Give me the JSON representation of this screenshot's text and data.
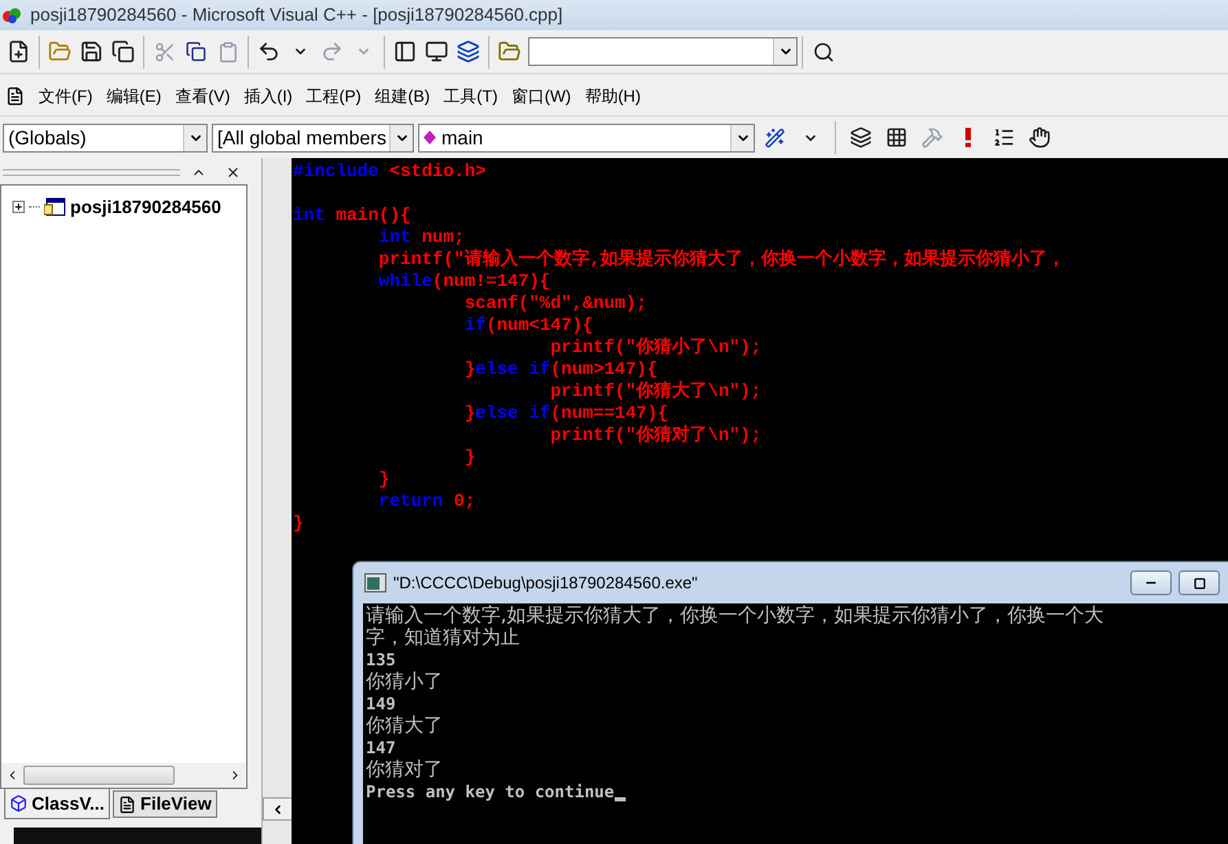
{
  "window": {
    "title": "posji18790284560 - Microsoft Visual C++ - [posji18790284560.cpp]"
  },
  "menu": [
    {
      "label": "文件(F)"
    },
    {
      "label": "编辑(E)"
    },
    {
      "label": "查看(V)"
    },
    {
      "label": "插入(I)"
    },
    {
      "label": "工程(P)"
    },
    {
      "label": "组建(B)"
    },
    {
      "label": "工具(T)"
    },
    {
      "label": "窗口(W)"
    },
    {
      "label": "帮助(H)"
    }
  ],
  "wizard_bar": {
    "scope": "(Globals)",
    "members": "[All global members",
    "function": "main"
  },
  "workspace": {
    "tree": [
      {
        "label": "posji18790284560",
        "expanded": false
      }
    ],
    "tabs": [
      {
        "label": "ClassV...",
        "selected": true
      },
      {
        "label": "FileView",
        "selected": false
      }
    ]
  },
  "editor": {
    "lines": [
      [
        {
          "kind": "keyword",
          "text": "#include"
        },
        {
          "kind": "plain",
          "text": " <stdio.h>"
        }
      ],
      [
        {
          "kind": "blank"
        }
      ],
      [
        {
          "kind": "keyword",
          "text": "int"
        },
        {
          "kind": "plain",
          "text": " main(){"
        }
      ],
      [
        {
          "kind": "keyword",
          "text": "        int"
        },
        {
          "kind": "plain",
          "text": " num;"
        }
      ],
      [
        {
          "kind": "plain",
          "text": "        printf(\"请输入一个数字,如果提示你猜大了，你换一个小数字，如果提示你猜小了，"
        }
      ],
      [
        {
          "kind": "keyword",
          "text": "        while"
        },
        {
          "kind": "plain",
          "text": "(num!=147){"
        }
      ],
      [
        {
          "kind": "plain",
          "text": "                scanf(\"%d\",&num);"
        }
      ],
      [
        {
          "kind": "keyword",
          "text": "                if"
        },
        {
          "kind": "plain",
          "text": "(num<147){"
        }
      ],
      [
        {
          "kind": "plain",
          "text": "                        printf(\"你猜小了\\n\");"
        }
      ],
      [
        {
          "kind": "plain",
          "text": "                }"
        },
        {
          "kind": "keyword",
          "text": "else if"
        },
        {
          "kind": "plain",
          "text": "(num>147){"
        }
      ],
      [
        {
          "kind": "plain",
          "text": "                        printf(\"你猜大了\\n\");"
        }
      ],
      [
        {
          "kind": "plain",
          "text": "                }"
        },
        {
          "kind": "keyword",
          "text": "else if"
        },
        {
          "kind": "plain",
          "text": "(num==147){"
        }
      ],
      [
        {
          "kind": "plain",
          "text": "                        printf(\"你猜对了\\n\");"
        }
      ],
      [
        {
          "kind": "plain",
          "text": "                }"
        }
      ],
      [
        {
          "kind": "plain",
          "text": "        }"
        }
      ],
      [
        {
          "kind": "keyword",
          "text": "        return"
        },
        {
          "kind": "plain",
          "text": " 0;"
        }
      ],
      [
        {
          "kind": "plain",
          "text": "}"
        }
      ]
    ]
  },
  "console": {
    "title": "\"D:\\CCCC\\Debug\\posji18790284560.exe\"",
    "cursor": true,
    "lines": [
      {
        "kind": "cjk",
        "text": "请输入一个数字,如果提示你猜大了，你换一个小数字，如果提示你猜小了，你换一个大"
      },
      {
        "kind": "cjk",
        "text": "字，知道猜对为止"
      },
      {
        "kind": "ascii",
        "text": "135"
      },
      {
        "kind": "cjk",
        "text": "你猜小了"
      },
      {
        "kind": "ascii",
        "text": "149"
      },
      {
        "kind": "cjk",
        "text": "你猜大了"
      },
      {
        "kind": "ascii",
        "text": "147"
      },
      {
        "kind": "cjk",
        "text": "你猜对了"
      },
      {
        "kind": "ascii",
        "text": "Press any key to continue"
      }
    ]
  }
}
